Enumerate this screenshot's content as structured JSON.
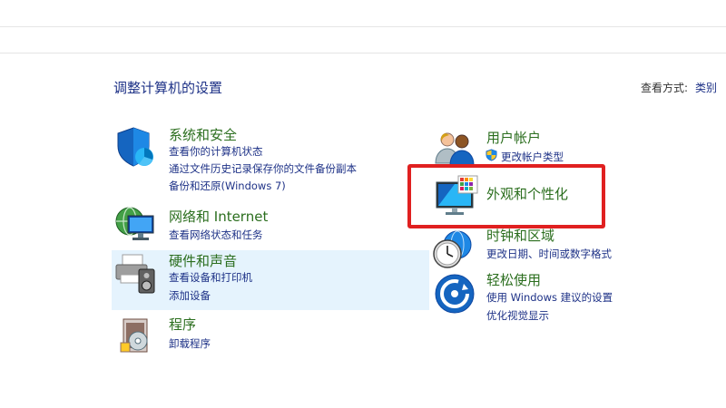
{
  "page": {
    "title": "调整计算机的设置",
    "view_by_label": "查看方式:",
    "view_by_value": "类别"
  },
  "categories_left": [
    {
      "title": "系统和安全",
      "icon": "shield-icon",
      "links": [
        "查看你的计算机状态",
        "通过文件历史记录保存你的文件备份副本",
        "备份和还原(Windows 7)"
      ]
    },
    {
      "title": "网络和 Internet",
      "icon": "network-icon",
      "links": [
        "查看网络状态和任务"
      ]
    },
    {
      "title": "硬件和声音",
      "icon": "printer-icon",
      "links": [
        "查看设备和打印机",
        "添加设备"
      ]
    },
    {
      "title": "程序",
      "icon": "programs-icon",
      "links": [
        "卸载程序"
      ]
    }
  ],
  "categories_right": [
    {
      "title": "用户帐户",
      "icon": "users-icon",
      "links": [
        "更改帐户类型"
      ]
    },
    {
      "title": "外观和个性化",
      "icon": "appearance-icon",
      "links": []
    },
    {
      "title": "时钟和区域",
      "icon": "clock-icon",
      "links": [
        "更改日期、时间或数字格式"
      ]
    },
    {
      "title": "轻松使用",
      "icon": "ease-of-access-icon",
      "links": [
        "使用 Windows 建议的设置",
        "优化视觉显示"
      ]
    }
  ],
  "colors": {
    "title_green": "#2b6e1e",
    "link_blue": "#1e3287",
    "highlight_red": "#e02020",
    "hover_bg": "#e5f3fd"
  }
}
